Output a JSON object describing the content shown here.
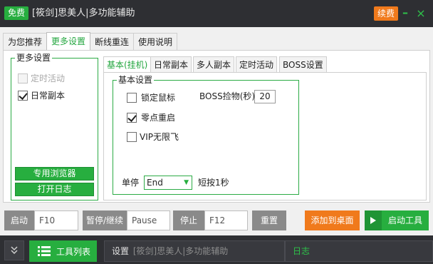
{
  "title_bar": {
    "badge_free": "免费",
    "app_title": "[筱剑]思美人|多功能辅助",
    "renew": "续费",
    "minimize": "–",
    "close": "×"
  },
  "main_tabs": [
    {
      "label": "为您推荐"
    },
    {
      "label": "更多设置",
      "active": true
    },
    {
      "label": "断线重连"
    },
    {
      "label": "使用说明"
    }
  ],
  "left_group": {
    "title": "更多设置",
    "checkboxes": [
      {
        "label": "定时活动",
        "checked": false,
        "disabled": true
      },
      {
        "label": "日常副本",
        "checked": true,
        "disabled": false
      }
    ],
    "btn_browser": "专用浏览器",
    "btn_log": "打开日志"
  },
  "sub_tabs": [
    {
      "label": "基本(挂机)",
      "active": true
    },
    {
      "label": "日常副本"
    },
    {
      "label": "多人副本"
    },
    {
      "label": "定时活动"
    },
    {
      "label": "BOSS设置"
    }
  ],
  "basic_settings": {
    "title": "基本设置",
    "lock_mouse": {
      "label": "锁定鼠标",
      "checked": false
    },
    "boss_pickup": {
      "label": "BOSS捡物(秒)",
      "value": "20"
    },
    "midnight_restart": {
      "label": "零点重启",
      "checked": true
    },
    "vip_fly": {
      "label": "VIP无限飞",
      "checked": false
    },
    "stop_label": "单停",
    "stop_key": "End",
    "short_press": "短按1秒"
  },
  "controls": {
    "start_label": "启动",
    "start_key": "F10",
    "pause_label": "暂停/继续",
    "pause_key": "Pause",
    "stop_label": "停止",
    "stop_key": "F12",
    "reset": "重置",
    "add_desktop": "添加到桌面",
    "start_tool": "启动工具"
  },
  "status_bar": {
    "tool_list": "工具列表",
    "settings_prefix": "设置",
    "settings_text": "[筱剑]思美人|多功能辅助",
    "log": "日志"
  },
  "colors": {
    "accent_green": "#27ae3f",
    "accent_orange": "#f07a1c",
    "dark_bar": "#2e2f33"
  }
}
